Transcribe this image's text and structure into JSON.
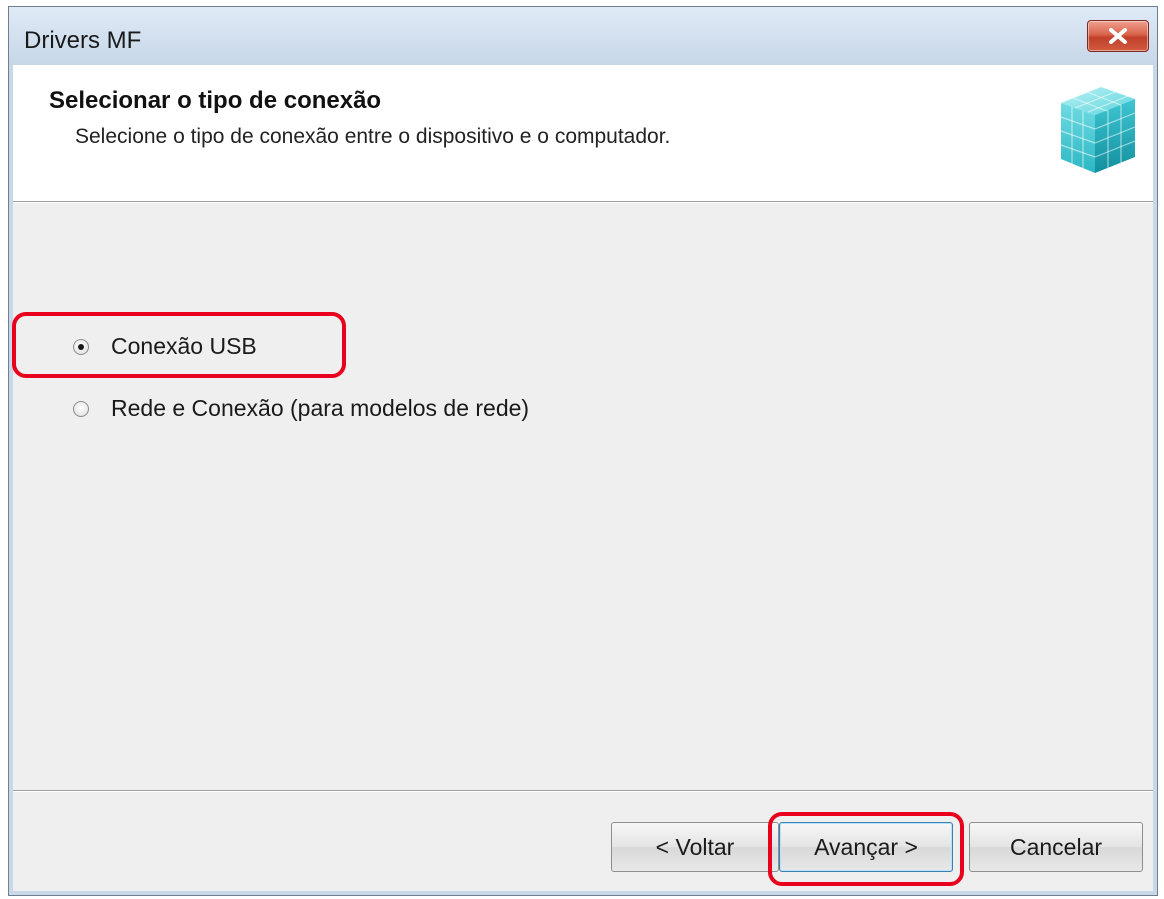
{
  "window": {
    "title": "Drivers MF"
  },
  "header": {
    "title": "Selecionar o tipo de conexão",
    "subtitle": "Selecione o tipo de conexão entre o dispositivo e o computador."
  },
  "options": [
    {
      "label": "Conexão USB",
      "checked": true
    },
    {
      "label": "Rede e Conexão (para modelos de rede)",
      "checked": false
    }
  ],
  "buttons": {
    "back_label": "< Voltar",
    "next_label": "Avançar >",
    "cancel_label": "Cancelar"
  },
  "colors": {
    "highlight": "#e8001c",
    "cube_light": "#7fe0e6",
    "cube_dark": "#1aa6b5"
  }
}
